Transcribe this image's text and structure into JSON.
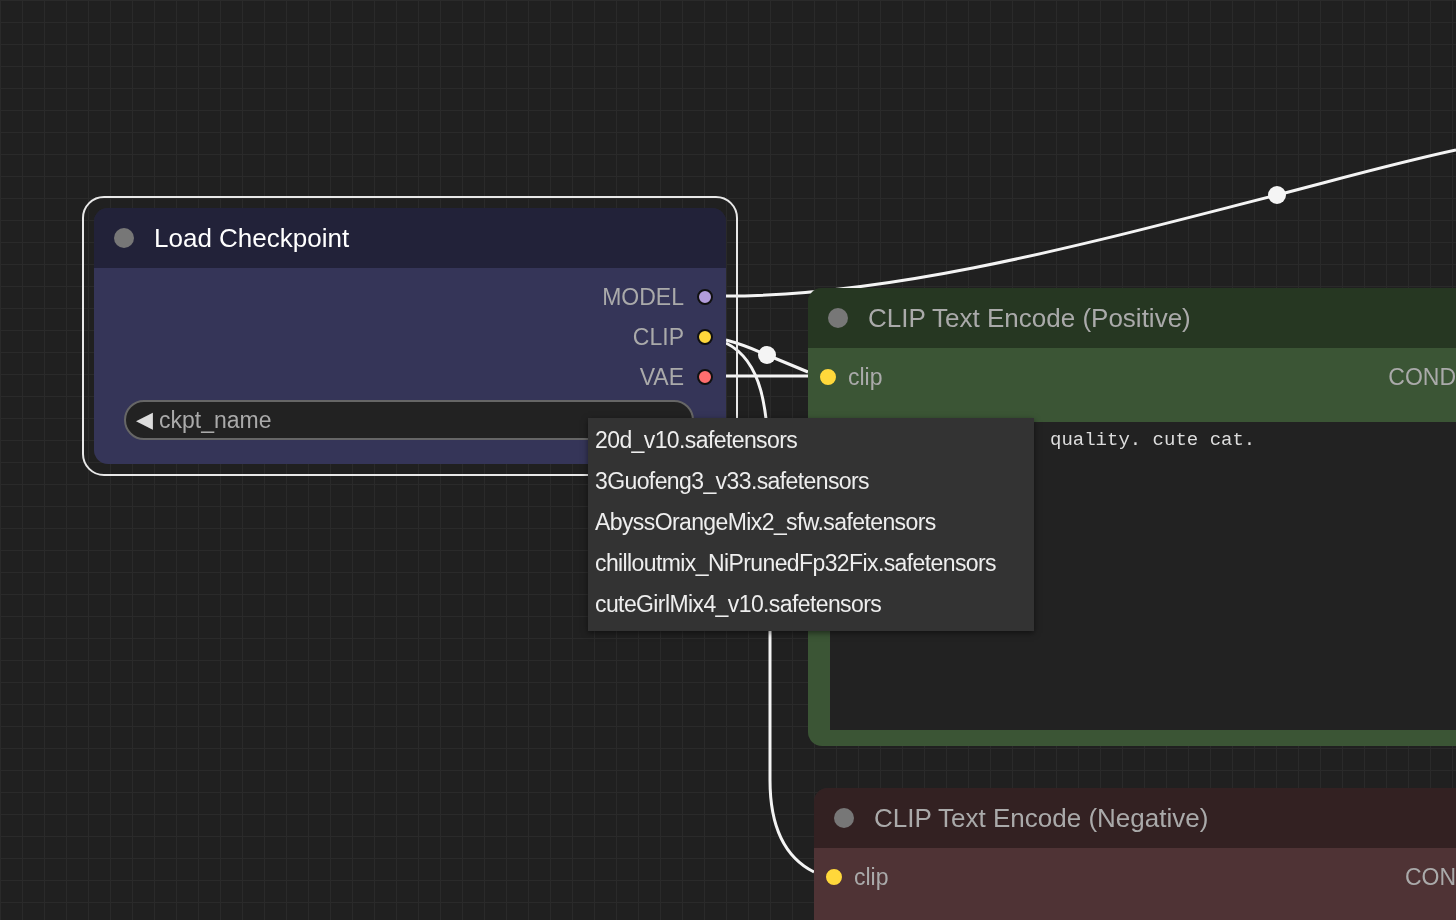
{
  "nodes": [
    {
      "kind": "loader",
      "title": "Load Checkpoint",
      "selected": true,
      "color": "#353558",
      "outputs": [
        {
          "label": "MODEL",
          "color": "#b39ddb"
        },
        {
          "label": "CLIP",
          "color": "#ffd83b"
        },
        {
          "label": "VAE",
          "color": "#ff6e6e"
        }
      ],
      "widget": {
        "left_arrow": "◀",
        "label": "ckpt_name"
      }
    },
    {
      "kind": "encoder",
      "title": "CLIP Text Encode (Positive)",
      "selected": false,
      "color": "#3b5535",
      "inputs": [
        {
          "label": "clip",
          "color": "#ffd83b"
        }
      ],
      "output": "COND",
      "text": "quality. cute cat."
    },
    {
      "kind": "encoder",
      "title": "CLIP Text Encode (Negative)",
      "selected": false,
      "color": "#4f3335",
      "inputs": [
        {
          "label": "clip",
          "color": "#ffd83b"
        }
      ],
      "output": "CON"
    }
  ],
  "menu": {
    "items": [
      "20d_v10.safetensors",
      "3Guofeng3_v33.safetensors",
      "AbyssOrangeMix2_sfw.safetensors",
      "chilloutmix_NiPrunedFp32Fix.safetensors",
      "cuteGirlMix4_v10.safetensors"
    ]
  }
}
